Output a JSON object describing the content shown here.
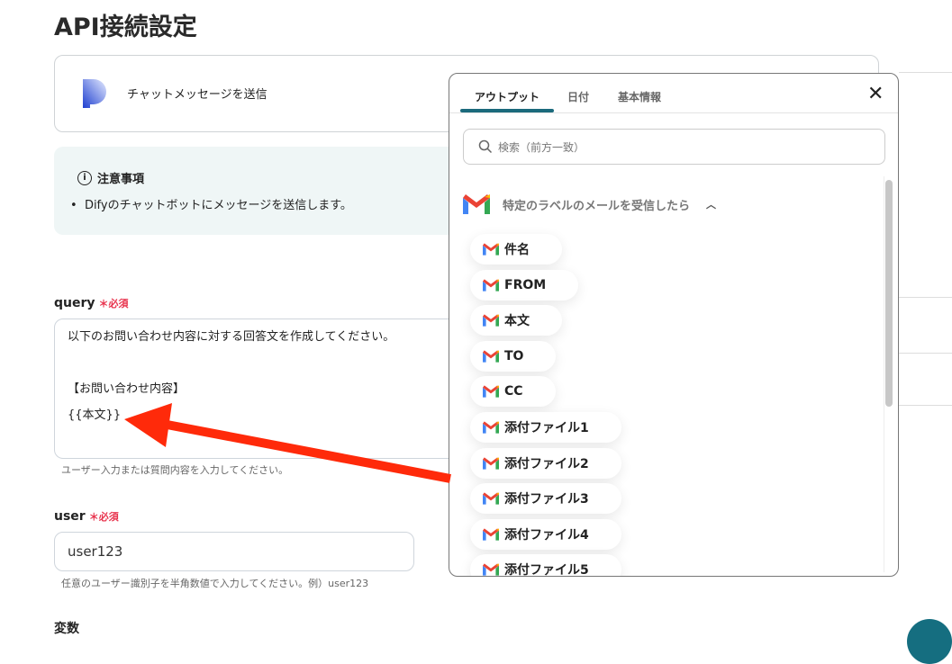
{
  "page": {
    "title": "API接続設定"
  },
  "action": {
    "name": "チャットメッセージを送信"
  },
  "notice": {
    "title": "注意事項",
    "items": [
      "Difyのチャットボットにメッセージを送信します。"
    ]
  },
  "query": {
    "label": "query",
    "required_mark": "＊",
    "required": "必須",
    "lines": [
      "以下のお問い合わせ内容に対する回答文を作成してください。",
      "",
      "【お問い合わせ内容】",
      "{{本文}}"
    ],
    "hint": "ユーザー入力または質問内容を入力してください。"
  },
  "user": {
    "label": "user",
    "required_mark": "＊",
    "required": "必須",
    "value": "user123",
    "hint": "任意のユーザー識別子を半角数値で入力してください。例）user123"
  },
  "variables": {
    "label": "変数"
  },
  "popup": {
    "tabs": [
      "アウトプット",
      "日付",
      "基本情報"
    ],
    "active_tab": 0,
    "search_placeholder": "検索（前方一致）",
    "section": "特定のラベルのメールを受信したら",
    "items": [
      "件名",
      "FROM",
      "本文",
      "TO",
      "CC",
      "添付ファイル1",
      "添付ファイル2",
      "添付ファイル3",
      "添付ファイル4",
      "添付ファイル5"
    ]
  },
  "colors": {
    "accent": "#1b6a7c",
    "required": "#e8344e",
    "arrow": "#ff2a0a"
  }
}
